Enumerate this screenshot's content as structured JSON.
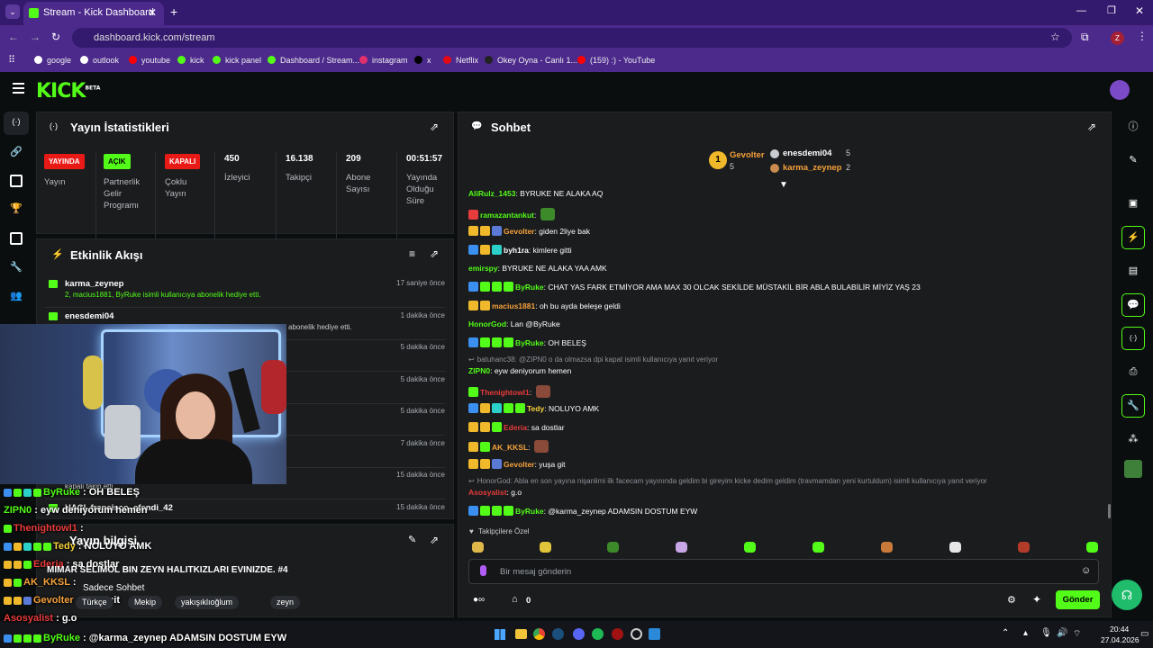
{
  "browser": {
    "tab_title": "Stream - Kick Dashboard",
    "url": "dashboard.kick.com/stream",
    "profile_letter": "Z",
    "bookmarks": [
      {
        "label": "google",
        "color": "#ffffff"
      },
      {
        "label": "outlook",
        "color": "#ffffff"
      },
      {
        "label": "youtube",
        "color": "#ff0000"
      },
      {
        "label": "kick",
        "color": "#53fc18"
      },
      {
        "label": "kick panel",
        "color": "#53fc18"
      },
      {
        "label": "Dashboard / Stream...",
        "color": "#53fc18"
      },
      {
        "label": "instagram",
        "color": "#e1306c"
      },
      {
        "label": "x",
        "color": "#000000"
      },
      {
        "label": "Netflix",
        "color": "#e50914"
      },
      {
        "label": "Okey Oyna - Canlı 1...",
        "color": "#222222"
      },
      {
        "label": "(159) :) - YouTube",
        "color": "#ff0000"
      }
    ]
  },
  "app": {
    "logo": "KICK",
    "logo_tag": "BETA"
  },
  "stats": {
    "title": "Yayın İstatistikleri",
    "live_badge": "YAYINDA",
    "live_label": "Yayın",
    "partner_badge": "AÇIK",
    "partner_label": "Partnerlik Gelir Programı",
    "multi_badge": "KAPALI",
    "multi_label": "Çoklu Yayın",
    "viewers": "450",
    "viewers_label": "İzleyici",
    "followers": "16.138",
    "followers_label": "Takipçi",
    "subs": "209",
    "subs_label": "Abone Sayısı",
    "uptime": "00:51:57",
    "uptime_label": "Yayında Olduğu Süre"
  },
  "activity": {
    "title": "Etkinlik Akışı",
    "items": [
      {
        "name": "karma_zeynep",
        "desc": "2, macius1881, ByRuke isimli kullanıcıya abonelik hediye etti.",
        "time": "17 saniye önce"
      },
      {
        "name": "enesdemi04",
        "desc": "abonelik hediye etti.",
        "time": "1 dakika önce"
      },
      {
        "name": "",
        "desc": "",
        "time": "5 dakika önce"
      },
      {
        "name": "",
        "desc": "",
        "time": "5 dakika önce"
      },
      {
        "name": "",
        "desc": "",
        "time": "5 dakika önce"
      },
      {
        "name": "",
        "desc": "",
        "time": "7 dakika önce"
      },
      {
        "name": "",
        "desc": "kapalı takip etti",
        "time": "15 dakika önce"
      },
      {
        "name": "HACI_fransisco_efendi_42",
        "desc": "",
        "time": "15 dakika önce"
      }
    ]
  },
  "streaminfo": {
    "title": "Yayın bilgisi",
    "stream_title": "MIMAR SELIMOL BIN ZEYN HALITKIZLARI EVINIZDE. #4",
    "category": "Sadece Sohbet",
    "tags": [
      "Türkçe",
      "Mekip",
      "yakışıklıoğlum",
      "zeyn"
    ]
  },
  "chat": {
    "title": "Sohbet",
    "leaders": [
      {
        "name": "Gevolter",
        "count": "5"
      },
      {
        "name": "enesdemi04",
        "count": "5"
      },
      {
        "name": "karma_zeynep",
        "count": "2"
      }
    ],
    "messages": [
      {
        "user": "AliRulz_1453",
        "color": "#53fc18",
        "text": "BYRUKE NE ALAKA AQ"
      },
      {
        "user": "ramazantankut",
        "color": "#53fc18",
        "text": ""
      },
      {
        "user": "Gevolter",
        "color": "#f7a23b",
        "text": "giden 2liye bak"
      },
      {
        "user": "byh1ra",
        "color": "#ffffff",
        "text": "kimlere gitti"
      },
      {
        "user": "emirspy",
        "color": "#53fc18",
        "text": "BYRUKE NE ALAKA YAA AMK"
      },
      {
        "user": "ByRuke",
        "color": "#53fc18",
        "text": "CHAT YAS FARK ETMİYOR AMA MAX 30 OLCAK SEKİLDE MÜSTAKİL BİR ABLA BULABİLİR MİYİZ YAŞ 23"
      },
      {
        "user": "macius1881",
        "color": "#f7a23b",
        "text": "oh bu ayda beleşe geldi"
      },
      {
        "user": "HonorGod",
        "color": "#53fc18",
        "text": "Lan @ByRuke"
      },
      {
        "user": "ByRuke",
        "color": "#53fc18",
        "text": "OH BELEŞ"
      },
      {
        "reply": "batuhanc38: @ZIPN0 o da olmazsa dpi kapat isimli kullanıcıya yanıt veriyor"
      },
      {
        "user": "ZIPN0",
        "color": "#53fc18",
        "text": "eyw deniyorum hemen"
      },
      {
        "user": "Thenightowl1",
        "color": "#e83b3b",
        "text": ""
      },
      {
        "user": "Tedy",
        "color": "#f7d23b",
        "text": "NOLUYO AMK"
      },
      {
        "user": "Ederia",
        "color": "#e83b3b",
        "text": "sa dostlar"
      },
      {
        "user": "AK_KKSL",
        "color": "#f7a23b",
        "text": ""
      },
      {
        "user": "Gevolter",
        "color": "#f7a23b",
        "text": "yuşa git"
      },
      {
        "reply": "HonorGod: Abla en son yayına nişanlimi ilk facecam yayınında geldim bi gireyim kicke dedim geldim (travmamdan yeni kurtuldum) isimli kullanıcıya yanıt veriyor"
      },
      {
        "user": "Asosyalist",
        "color": "#e83b3b",
        "text": "g.o"
      },
      {
        "user": "ByRuke",
        "color": "#53fc18",
        "text": "@karma_zeynep ADAMSIN DOSTUM EYW"
      }
    ],
    "emote_section": "Takipçilere Özel",
    "input_placeholder": "Bir mesaj gönderin",
    "gift_count": "0",
    "send_label": "Gönder"
  },
  "overlay": [
    {
      "user": "ByRuke",
      "color": "#53fc18",
      "text": "OH BELEŞ"
    },
    {
      "user": "ZIPN0",
      "color": "#53fc18",
      "text": "eyw deniyorum hemen"
    },
    {
      "user": "Thenightowl1",
      "color": "#e83b3b",
      "text": ""
    },
    {
      "user": "Tedy",
      "color": "#f7d23b",
      "text": "NOLUYO AMK"
    },
    {
      "user": "Ederia",
      "color": "#e83b3b",
      "text": "sa dostlar"
    },
    {
      "user": "AK_KKSL",
      "color": "#f7a23b",
      "text": ""
    },
    {
      "user": "Gevolter",
      "color": "#f7a23b",
      "text": "yuşa git"
    },
    {
      "user": "Asosyalist",
      "color": "#e83b3b",
      "text": "g.o"
    },
    {
      "user": "ByRuke",
      "color": "#53fc18",
      "text": "@karma_zeynep ADAMSIN DOSTUM EYW"
    }
  ],
  "taskbar": {
    "time": "20:44",
    "date": "27.04.2026"
  },
  "colors": {
    "accent": "#53fc18",
    "live_red": "#e91916",
    "browser_purple": "#4c2a8c"
  }
}
